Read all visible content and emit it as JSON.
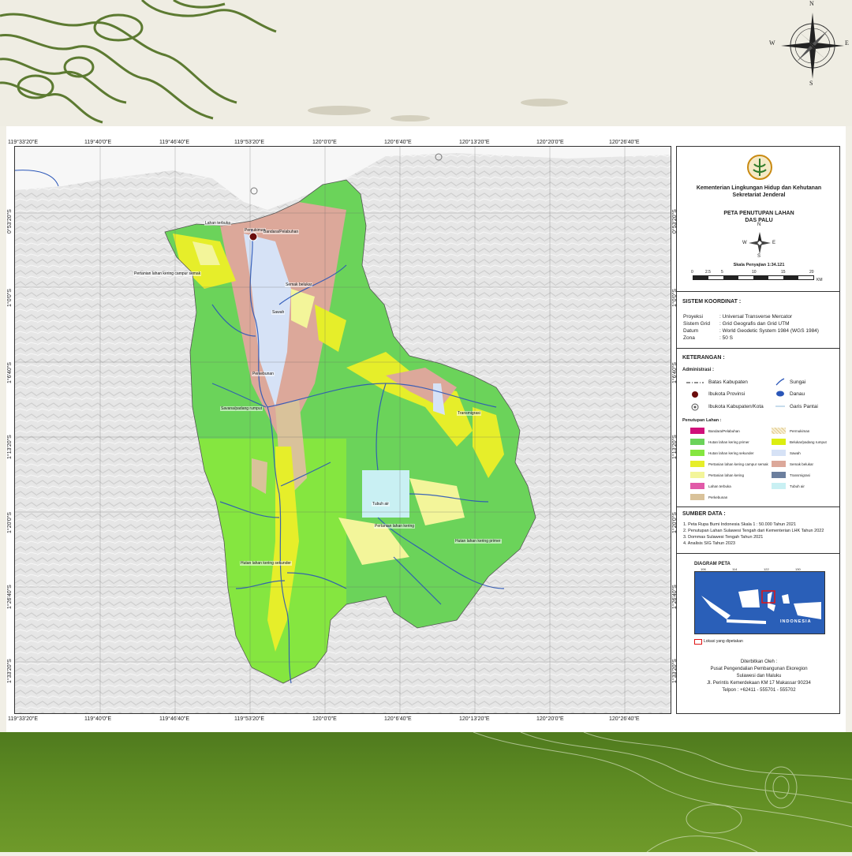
{
  "colors": {
    "hutan_primer": "#6bd35a",
    "hutan_sekunder": "#85e640",
    "pertanian_campur": "#e6ee2a",
    "pertanian": "#f3f59a",
    "lahan_terbuka": "#e15aa8",
    "perkebunan": "#d9c29a",
    "bandara": "#d0107a",
    "belukar_rawa": "#dcee10",
    "sawah": "#d6e2f6",
    "semak_belukar": "#dca89a",
    "transmigrasi": "#6c7f9e",
    "tubuh_air": "#c9f0f3",
    "permukiman": "#f6efd6",
    "river": "#2a56b8",
    "band_green": "#5d8a22"
  },
  "icons": {
    "compass": "compass-rose-icon",
    "logo": "klhk-logo-icon",
    "capital": "provincial-capital-icon",
    "regency": "regency-capital-icon"
  },
  "compass": {
    "n": "N",
    "s": "S",
    "e": "E",
    "w": "W"
  },
  "map": {
    "lon_labels": [
      "119°33'20\"E",
      "119°40'0\"E",
      "119°46'40\"E",
      "119°53'20\"E",
      "120°0'0\"E",
      "120°6'40\"E",
      "120°13'20\"E",
      "120°20'0\"E",
      "120°26'40\"E"
    ],
    "lat_labels": [
      "0°53'20\"S",
      "1°0'0\"S",
      "1°6'40\"S",
      "1°13'20\"S",
      "1°20'0\"S",
      "1°26'40\"S",
      "1°33'20\"S"
    ],
    "labels": {
      "lahan_terbuka": "Lahan terbuka",
      "permukiman": "Pemukiman",
      "bandara": "Bandara/Pelabuhan",
      "pertanian_campur": "Pertanian lahan kering campur semak",
      "semak": "Semak belukar",
      "sawah": "Sawah",
      "perkebunan": "Perkebunan",
      "savana": "Savana/padang rumput",
      "transmigrasi": "Transmigrasi",
      "tubuh_air": "Tubuh air",
      "pertanian": "Pertanian lahan kering",
      "hutan_primer": "Hutan lahan kering primer",
      "hutan_sekunder": "Hutan lahan kering sekunder"
    }
  },
  "legend": {
    "ministry": "Kementerian Lingkungan Hidup dan Kehutanan",
    "secretariat": "Sekretariat Jenderal",
    "map_title": "PETA PENUTUPAN LAHAN",
    "map_subtitle": "DAS PALU",
    "scale_text": "Skala Penyajian 1:34.121",
    "scale_ticks": [
      "0",
      "2.5",
      "5",
      "10",
      "15",
      "20"
    ],
    "scale_unit": "KM",
    "coord_heading": "SISTEM KOORDINAT :",
    "coord": [
      {
        "k": "Proyeksi",
        "v": ": Universal Transverse Mercator"
      },
      {
        "k": "Sistem Grid",
        "v": ": Grid Geografis dan Grid UTM"
      },
      {
        "k": "Datum",
        "v": ": World Geodetic System 1984 (WGS 1984)"
      },
      {
        "k": "Zona",
        "v": ": 50 S"
      }
    ],
    "keterangan": "KETERANGAN :",
    "admin_heading": "Administrasi :",
    "admin": {
      "batas": "Batas Kabupaten",
      "ibukota_prov": "Ibukota Provinsi",
      "ibukota_kab": "Ibukota Kabupaten/Kota",
      "sungai": "Sungai",
      "danau": "Danau",
      "garis_pantai": "Garis Pantai"
    },
    "landcover_heading": "Penutupan Lahan :",
    "landcover_left": [
      "Bandara/Pelabuhan",
      "Hutan lahan kering primer",
      "Hutan lahan kering sekunder",
      "Pertanian lahan kering campur semak",
      "Pertanian lahan kering",
      "Lahan terbuka",
      "Perkebunan"
    ],
    "landcover_right": [
      "Permukiman",
      "Belukar/padang rumput",
      "Sawah",
      "Semak belukar",
      "Transmigrasi",
      "Tubuh air"
    ],
    "source_heading": "SUMBER DATA :",
    "sources": [
      "1. Peta Rupa Bumi Indonesia Skala 1 : 50.000 Tahun 2021",
      "2. Penutupan Lahan Sulawesi Tengah dari Kementerian LHK Tahun 2022",
      "3. Dommas Sulawesi Tengah Tahun 2021",
      "4. Analisis SIG Tahun 2023"
    ],
    "diagram_heading": "DIAGRAM PETA",
    "inset_country": "INDONESIA",
    "inset_lon": [
      "106",
      "114",
      "122",
      "130"
    ],
    "inset_key": "Lokasi yang dipetakan",
    "publisher_lines": [
      "Diterbitkan Oleh :",
      "Pusat Pengendalian Pembangunan Ekoregion",
      "Sulawesi dan Maluku",
      "Jl. Perintis Kemerdekaan KM 17 Makassar 90234",
      "Telpon : +62411 - 555701 - 555702"
    ]
  }
}
